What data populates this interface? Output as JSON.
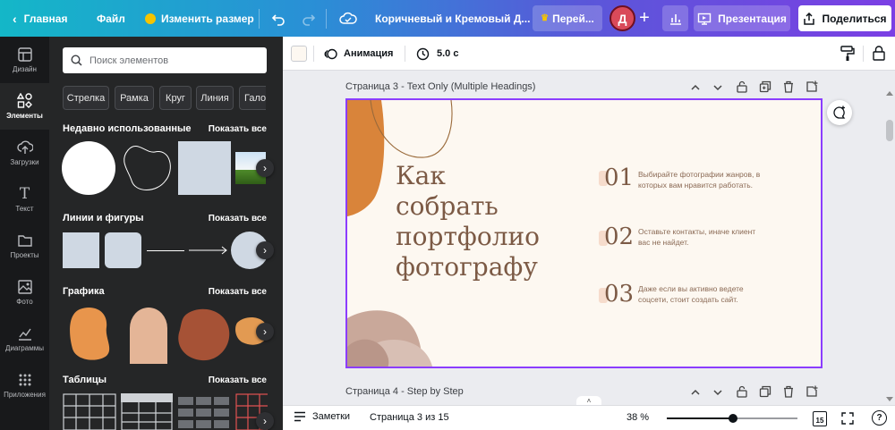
{
  "topbar": {
    "home": "Главная",
    "file": "Файл",
    "resize": "Изменить размер",
    "doc_title": "Коричневый и Кремовый Д...",
    "upgrade": "Перей...",
    "avatar_letter": "Д",
    "present": "Презентация",
    "share": "Поделиться"
  },
  "rail": {
    "items": [
      {
        "label": "Дизайн",
        "icon": "layout-icon"
      },
      {
        "label": "Элементы",
        "icon": "elements-icon"
      },
      {
        "label": "Загрузки",
        "icon": "upload-icon"
      },
      {
        "label": "Текст",
        "icon": "text-icon"
      },
      {
        "label": "Проекты",
        "icon": "folder-icon"
      },
      {
        "label": "Фото",
        "icon": "photo-icon"
      },
      {
        "label": "Диаграммы",
        "icon": "chart-icon"
      },
      {
        "label": "Приложения",
        "icon": "apps-icon"
      }
    ]
  },
  "panel": {
    "search_placeholder": "Поиск элементов",
    "chips": [
      "Стрелка",
      "Рамка",
      "Круг",
      "Линия",
      "Гало"
    ],
    "show_all": "Показать все",
    "sections": {
      "recent": "Недавно использованные",
      "lines": "Линии и фигуры",
      "graphics": "Графика",
      "tables": "Таблицы"
    }
  },
  "toolbar": {
    "animation": "Анимация",
    "duration": "5.0 с"
  },
  "canvas": {
    "page_title": "Страница 3 - Text Only (Multiple Headings)",
    "next_page_title": "Страница 4 - Step by Step"
  },
  "slide": {
    "heading_lines": [
      "Как",
      "собрать",
      "портфолио",
      "фотографу"
    ],
    "items": [
      {
        "num": "01",
        "text_lines": [
          "Выбирайте фотографии жанров, в",
          "которых вам нравится работать."
        ]
      },
      {
        "num": "02",
        "text_lines": [
          "Оставьте контакты, иначе клиент",
          "вас не найдет."
        ]
      },
      {
        "num": "03",
        "text_lines": [
          "Даже если вы активно ведете",
          "соцсети, стоит создать сайт."
        ]
      }
    ]
  },
  "bottom": {
    "notes": "Заметки",
    "page_indicator": "Страница 3 из 15",
    "zoom": "38 %",
    "zoom_level": 0.38,
    "page_count_badge": "15"
  },
  "colors": {
    "accent": "#8b3dff",
    "slide_bg": "#fdf8f1",
    "brown_text": "#7c5a45",
    "orange_shape": "#d9843a"
  }
}
